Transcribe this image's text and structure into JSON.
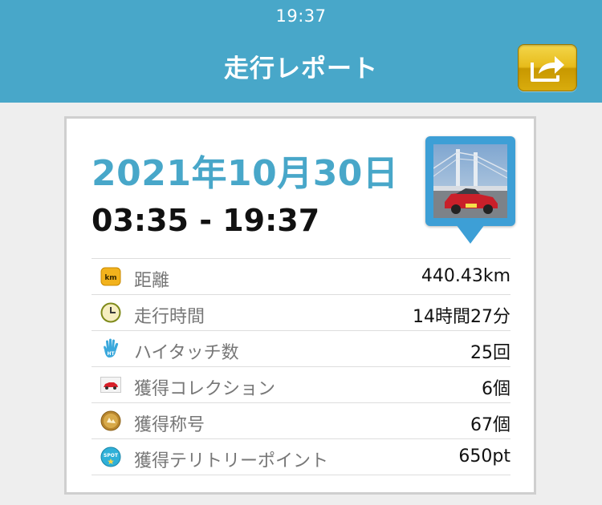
{
  "status_bar": {
    "time": "19:37"
  },
  "header": {
    "title": "走行レポート",
    "share_icon": "share-arrow-icon"
  },
  "report": {
    "date": "2021年10月30日",
    "time_range": "03:35 - 19:37",
    "photo_icon": "photo-pin-icon"
  },
  "stats": [
    {
      "icon": "km-icon",
      "label": "距離",
      "value": "440.43km"
    },
    {
      "icon": "clock-icon",
      "label": "走行時間",
      "value": "14時間27分"
    },
    {
      "icon": "hand-icon",
      "label": "ハイタッチ数",
      "value": "25回"
    },
    {
      "icon": "car-icon",
      "label": "獲得コレクション",
      "value": "6個"
    },
    {
      "icon": "medal-icon",
      "label": "獲得称号",
      "value": "67個"
    },
    {
      "icon": "spot-icon",
      "label": "獲得テリトリーポイント",
      "value": "650pt"
    }
  ],
  "colors": {
    "header": "#48a7c9",
    "accent_text": "#48a7c9",
    "share_button": "#e7bb1b",
    "pin": "#3d9fd6"
  }
}
